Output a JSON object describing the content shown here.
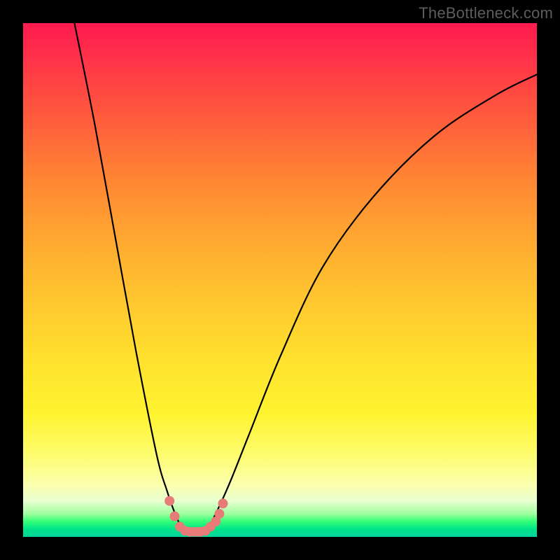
{
  "watermark": "TheBottleneck.com",
  "chart_data": {
    "type": "line",
    "title": "",
    "xlabel": "",
    "ylabel": "",
    "xlim": [
      0,
      100
    ],
    "ylim": [
      0,
      100
    ],
    "background_gradient_meaning": "color scale from red (high/bad) at top to green (low/good) at bottom, implying lower values are optimal",
    "series": [
      {
        "name": "bottleneck-curve",
        "color": "#000000",
        "x": [
          10,
          14,
          18,
          22,
          26,
          28,
          30,
          31,
          32,
          33,
          34,
          35,
          36,
          37,
          40,
          44,
          50,
          58,
          68,
          80,
          92,
          100
        ],
        "y": [
          100,
          80,
          58,
          36,
          16,
          9,
          3.5,
          2,
          1.2,
          1,
          1,
          1.2,
          2,
          3.5,
          10,
          20,
          35,
          52,
          66,
          78,
          86,
          90
        ]
      },
      {
        "name": "trough-markers",
        "color": "#e77b78",
        "type": "scatter",
        "x": [
          28.5,
          29.5,
          30.5,
          31.5,
          32.5,
          33.5,
          34.5,
          35.5,
          36.5,
          37.5,
          38.2,
          38.9
        ],
        "y": [
          7.0,
          4.0,
          2.0,
          1.2,
          1.0,
          1.0,
          1.0,
          1.2,
          2.0,
          3.0,
          4.5,
          6.5
        ]
      }
    ],
    "note": "Axes unlabeled in source image; x and y values are estimated on a 0–100 scale from pixel positions."
  }
}
